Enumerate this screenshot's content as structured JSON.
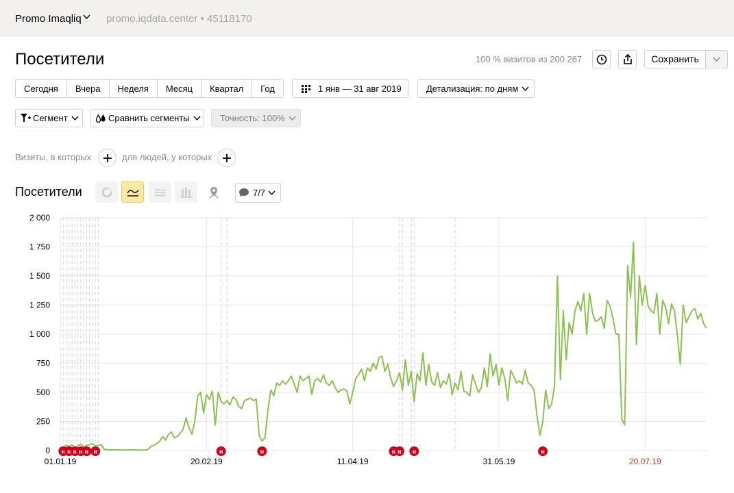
{
  "header": {
    "counter_name": "Promo Imaqliq",
    "counter_meta": "promo.iqdata.center • 45118170"
  },
  "title": "Посетители",
  "sample_info": "100 % визитов из 200 267",
  "toolbar": {
    "save_label": "Сохранить"
  },
  "periods": [
    "Сегодня",
    "Вчера",
    "Неделя",
    "Месяц",
    "Квартал",
    "Год"
  ],
  "date_range": "1 янв — 31 авг 2019",
  "detail": "Детализация: по дням",
  "segment": "Сегмент",
  "compare": "Сравнить сегменты",
  "accuracy": "Точность: 100%",
  "conditions": {
    "visits_text": "Визиты, в которых",
    "people_text": "для людей, у которых"
  },
  "chart_section": {
    "title": "Посетители",
    "annotations_label": "7/7"
  },
  "chart_data": {
    "type": "line",
    "series": [
      {
        "color": "#8cc152",
        "values": [
          15,
          30,
          45,
          35,
          50,
          20,
          40,
          55,
          30,
          45,
          50,
          60,
          40,
          45,
          50,
          10,
          8,
          6,
          7,
          5,
          6,
          4,
          5,
          5,
          6,
          5,
          4,
          5,
          3,
          4,
          10,
          35,
          45,
          60,
          80,
          120,
          90,
          140,
          160,
          110,
          120,
          150,
          180,
          280,
          200,
          140,
          250,
          470,
          500,
          320,
          480,
          440,
          510,
          220,
          500,
          420,
          400,
          430,
          390,
          460,
          440,
          380,
          360,
          430,
          440,
          450,
          430,
          440,
          130,
          80,
          110,
          350,
          520,
          470,
          580,
          560,
          600,
          570,
          600,
          640,
          570,
          500,
          640,
          600,
          620,
          640,
          480,
          600,
          620,
          590,
          650,
          580,
          560,
          600,
          540,
          500,
          520,
          530,
          510,
          400,
          500,
          620,
          650,
          700,
          600,
          710,
          680,
          750,
          700,
          800,
          810,
          680,
          740,
          620,
          550,
          600,
          670,
          520,
          780,
          560,
          680,
          420,
          660,
          600,
          840,
          560,
          740,
          590,
          560,
          670,
          540,
          600,
          570,
          660,
          480,
          580,
          520,
          680,
          510,
          500,
          470,
          650,
          570,
          500,
          540,
          710,
          550,
          830,
          640,
          740,
          560,
          710,
          620,
          430,
          690,
          640,
          580,
          600,
          570,
          690,
          580,
          560,
          520,
          300,
          130,
          250,
          520,
          360,
          400,
          550,
          1500,
          610,
          1200,
          780,
          1100,
          1000,
          1200,
          1280,
          1200,
          1350,
          1000,
          1350,
          1180,
          1110,
          1120,
          1150,
          1050,
          1290,
          1240,
          1130,
          1000,
          1000,
          270,
          220,
          1590,
          1320,
          1790,
          910,
          1500,
          1250,
          1420,
          1240,
          1200,
          1180,
          1350,
          1000,
          1290,
          1230,
          1090,
          1260,
          1200,
          1000,
          740,
          1250,
          1100,
          1150,
          1200,
          1220,
          1130,
          1180,
          1090,
          1050
        ]
      }
    ],
    "ylim": [
      0,
      2000
    ],
    "yticks": [
      "2 000",
      "1 750",
      "1 500",
      "1 250",
      "1 000",
      "750",
      "500",
      "250",
      "0"
    ],
    "xticks": [
      {
        "label": "01.01.19",
        "color": "#000000"
      },
      {
        "label": "20.02.19",
        "color": "#000000"
      },
      {
        "label": "11.04.19",
        "color": "#000000"
      },
      {
        "label": "31.05.19",
        "color": "#000000"
      },
      {
        "label": "20.07.19",
        "color": "#c0392b"
      }
    ],
    "marker_label": "н",
    "marker_color": "#d0021b",
    "line_color": "#8cc152",
    "grid": true
  }
}
